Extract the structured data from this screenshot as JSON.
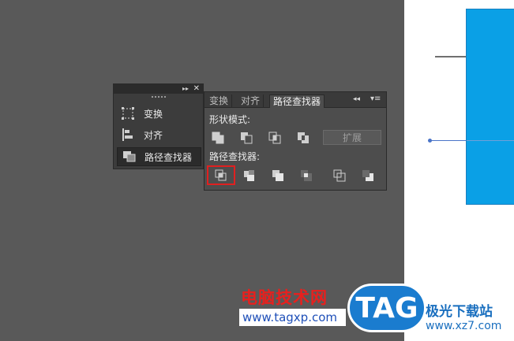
{
  "dock": {
    "items": [
      {
        "label": "变换",
        "icon": "transform-icon"
      },
      {
        "label": "对齐",
        "icon": "align-icon"
      },
      {
        "label": "路径查找器",
        "icon": "pathfinder-icon"
      }
    ],
    "expand_icon": "▸▸",
    "close_icon": "✕"
  },
  "panel": {
    "tabs": [
      {
        "label": "变换"
      },
      {
        "label": "对齐"
      },
      {
        "label": "路径查找器"
      }
    ],
    "collapse_icon": "◂◂",
    "menu_icon": "▾≡",
    "shape_modes_label": "形状模式:",
    "pathfinders_label": "路径查找器:",
    "expand_button_label": "扩展",
    "shape_mode_tools": [
      "unite-icon",
      "minus-front-icon",
      "intersect-icon",
      "exclude-icon"
    ],
    "pathfinder_tools": [
      "divide-icon",
      "trim-icon",
      "merge-icon",
      "crop-icon",
      "outline-icon",
      "minus-back-icon"
    ]
  },
  "watermark": {
    "brand_cn": "电脑技术网",
    "brand_url": "www.tagxp.com",
    "tag_logo": "TAG",
    "site_cn": "极光下载站",
    "site_url": "www.xz7.com"
  },
  "colors": {
    "workspace": "#595959",
    "artboard_shape": "#0aa0e6",
    "highlight": "#e02020"
  }
}
